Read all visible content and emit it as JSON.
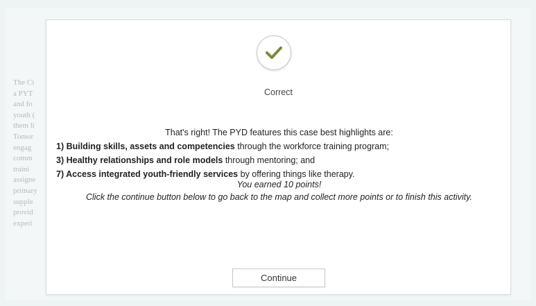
{
  "background": {
    "text_fragments": [
      "The Ci",
      "a PYT",
      "and fo",
      "youth (",
      "them li",
      "Tomor",
      "engag",
      "comm",
      "traini",
      "assigne",
      "primary",
      "supple",
      "provid",
      "experi"
    ]
  },
  "modal": {
    "icon": "checkmark-icon",
    "status_label": "Correct",
    "intro": "That's right! The PYD features this case best highlights are:",
    "items": [
      {
        "bold": "1) Building skills, assets and competencies",
        "rest": " through the workforce training program;"
      },
      {
        "bold": "3) Healthy relationships and role models",
        "rest": " through mentoring; and"
      },
      {
        "bold": "7) Access integrated youth-friendly services",
        "rest": " by offering things like therapy."
      }
    ],
    "points_text": "You earned 10 points!",
    "instruction": "Click the continue button below to go back to the map and collect more points or to finish this activity.",
    "continue_label": "Continue"
  },
  "colors": {
    "check": "#7a8a3a",
    "page_bg": "#eef3f4"
  }
}
